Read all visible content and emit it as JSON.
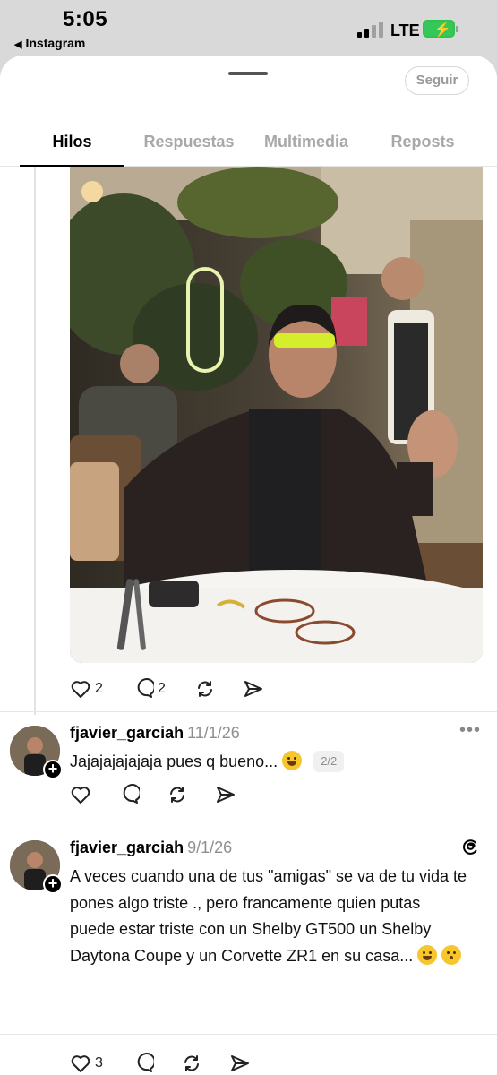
{
  "status_bar": {
    "time": "5:05",
    "back_app": "Instagram",
    "network": "LTE",
    "battery_color": "#35c759"
  },
  "header": {
    "follow_label": "Seguir",
    "tabs": [
      {
        "label": "Hilos",
        "active": true
      },
      {
        "label": "Respuestas",
        "active": false
      },
      {
        "label": "Multimedia",
        "active": false
      },
      {
        "label": "Reposts",
        "active": false
      }
    ]
  },
  "first_post": {
    "likes": "2",
    "comments": "2",
    "photo_alt": "photo"
  },
  "replies": [
    {
      "username": "fjavier_garciah",
      "date": "11/1/26",
      "text": "Jajajajajajaja pues q bueno...",
      "badge": "2/2",
      "likes": "",
      "comments": ""
    },
    {
      "username": "fjavier_garciah",
      "date": "9/1/26",
      "text": "A veces cuando una de tus \"amigas\"  se va de tu vida te pones algo triste ., pero francamente quien putas puede estar triste con un Shelby GT500 un Shelby Daytona Coupe y un Corvette ZR1 en su casa...",
      "likes": "3",
      "comments": ""
    }
  ]
}
